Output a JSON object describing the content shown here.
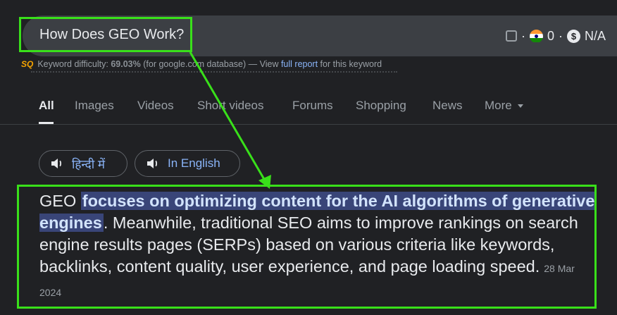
{
  "search": {
    "query": "How Does GEO Work?"
  },
  "extension": {
    "separator": "·",
    "count": "0",
    "value": "N/A"
  },
  "keyword_bar": {
    "logo": "SQ",
    "prefix": "Keyword difficulty:",
    "percent": "69.03%",
    "db": "(for google.com database) — View",
    "link": "full report",
    "suffix": "for this keyword"
  },
  "tabs": [
    "All",
    "Images",
    "Videos",
    "Short videos",
    "Forums",
    "Shopping",
    "News",
    "More"
  ],
  "language_buttons": [
    "हिन्दी में",
    "In English"
  ],
  "answer": {
    "lead": "GEO",
    "highlight": "focuses on optimizing content for the AI algorithms of generative engines",
    "rest": ". Meanwhile, traditional SEO aims to improve rankings on search engine results pages (SERPs) based on various criteria like keywords, backlinks, content quality, user experience, and page loading speed.",
    "date": "28 Mar 2024"
  },
  "colors": {
    "annotation": "#39e01a",
    "highlight_bg": "#394578",
    "link": "#8ab4f8",
    "background": "#202124"
  }
}
